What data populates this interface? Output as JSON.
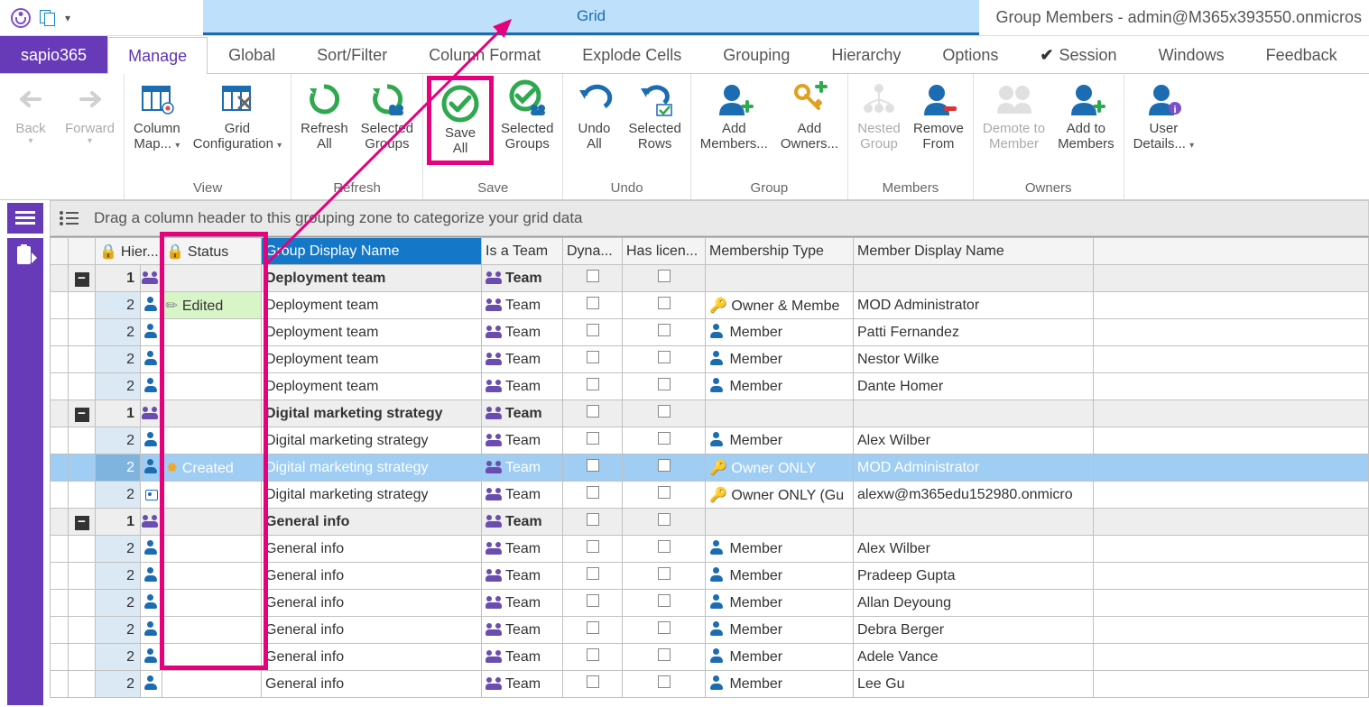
{
  "title_context_tab": "Grid",
  "window_title": "Group Members - admin@M365x393550.onmicros",
  "app_tab": "sapio365",
  "tabs": [
    "Manage",
    "Global",
    "Sort/Filter",
    "Column Format",
    "Explode Cells",
    "Grouping",
    "Hierarchy",
    "Options",
    "Session",
    "Windows",
    "Feedback"
  ],
  "active_tab": "Manage",
  "ribbon": {
    "nav": {
      "back": "Back",
      "forward": "Forward"
    },
    "view": {
      "colmap": "Column\nMap... ",
      "gridconf": "Grid\nConfiguration ",
      "label": "View"
    },
    "refresh": {
      "all": "Refresh\nAll",
      "sel": "Selected\nGroups",
      "label": "Refresh"
    },
    "save": {
      "all": "Save\nAll",
      "sel": "Selected\nGroups",
      "label": "Save"
    },
    "undo": {
      "all": "Undo\nAll",
      "sel": "Selected\nRows",
      "label": "Undo"
    },
    "group": {
      "addm": "Add\nMembers...",
      "addo": "Add\nOwners...",
      "label": "Group"
    },
    "members": {
      "nested": "Nested\nGroup",
      "remove": "Remove\nFrom",
      "label": "Members"
    },
    "owners": {
      "demote": "Demote to\nMember",
      "addto": "Add to\nMembers",
      "label": "Owners"
    },
    "userdetails": "User\nDetails... "
  },
  "groupzone_hint": "Drag a column header to this grouping zone to categorize your grid data",
  "columns": {
    "hier": "Hier...",
    "status": "Status",
    "group": "Group Display Name",
    "team": "Is a Team",
    "dyn": "Dyna...",
    "lic": "Has licen...",
    "memb": "Membership Type",
    "name": "Member Display Name"
  },
  "rows": [
    {
      "type": "group",
      "hier": "1",
      "group": "Deployment team",
      "team": "Team"
    },
    {
      "type": "child",
      "hier": "2",
      "status": "Edited",
      "status_kind": "edited",
      "group": "Deployment team",
      "team": "Team",
      "memb": "Owner & Membe",
      "memb_icon": "key",
      "name": "MOD Administrator"
    },
    {
      "type": "child",
      "hier": "2",
      "group": "Deployment team",
      "team": "Team",
      "memb": "Member",
      "memb_icon": "person",
      "name": "Patti Fernandez"
    },
    {
      "type": "child",
      "hier": "2",
      "group": "Deployment team",
      "team": "Team",
      "memb": "Member",
      "memb_icon": "person",
      "name": "Nestor Wilke"
    },
    {
      "type": "child",
      "hier": "2",
      "group": "Deployment team",
      "team": "Team",
      "memb": "Member",
      "memb_icon": "person",
      "name": "Dante Homer"
    },
    {
      "type": "group",
      "hier": "1",
      "group": "Digital marketing strategy",
      "team": "Team"
    },
    {
      "type": "child",
      "hier": "2",
      "group": "Digital marketing strategy",
      "team": "Team",
      "memb": "Member",
      "memb_icon": "person",
      "name": "Alex Wilber"
    },
    {
      "type": "child",
      "hier": "2",
      "selected": true,
      "status": "Created",
      "status_kind": "created",
      "group": "Digital marketing strategy",
      "team": "Team",
      "memb": "Owner ONLY",
      "memb_icon": "keyblue",
      "name": "MOD Administrator"
    },
    {
      "type": "child",
      "hier": "2",
      "row_icon": "card",
      "group": "Digital marketing strategy",
      "team": "Team",
      "memb": "Owner ONLY (Gu",
      "memb_icon": "keyorange",
      "name": "alexw@m365edu152980.onmicro"
    },
    {
      "type": "group",
      "hier": "1",
      "group": "General info",
      "team": "Team"
    },
    {
      "type": "child",
      "hier": "2",
      "group": "General info",
      "team": "Team",
      "memb": "Member",
      "memb_icon": "person",
      "name": "Alex Wilber"
    },
    {
      "type": "child",
      "hier": "2",
      "group": "General info",
      "team": "Team",
      "memb": "Member",
      "memb_icon": "person",
      "name": "Pradeep Gupta"
    },
    {
      "type": "child",
      "hier": "2",
      "group": "General info",
      "team": "Team",
      "memb": "Member",
      "memb_icon": "person",
      "name": "Allan Deyoung"
    },
    {
      "type": "child",
      "hier": "2",
      "group": "General info",
      "team": "Team",
      "memb": "Member",
      "memb_icon": "person",
      "name": "Debra Berger"
    },
    {
      "type": "child",
      "hier": "2",
      "group": "General info",
      "team": "Team",
      "memb": "Member",
      "memb_icon": "person",
      "name": "Adele Vance"
    },
    {
      "type": "child",
      "hier": "2",
      "group": "General info",
      "team": "Team",
      "memb": "Member",
      "memb_icon": "person",
      "name": "Lee Gu"
    }
  ]
}
